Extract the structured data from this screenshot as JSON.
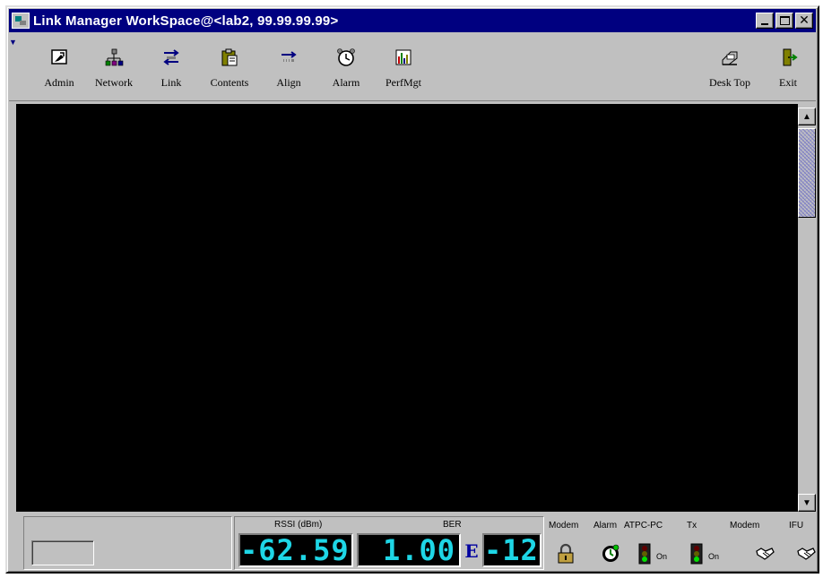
{
  "window": {
    "title": "Link Manager WorkSpace@<lab2, 99.99.99.99>"
  },
  "titlebar_buttons": {
    "minimize": "_",
    "maximize": "□",
    "close": "✕"
  },
  "toolbar": {
    "items": [
      {
        "label": "Admin",
        "icon": "admin-icon"
      },
      {
        "label": "Network",
        "icon": "network-icon"
      },
      {
        "label": "Link",
        "icon": "link-icon"
      },
      {
        "label": "Contents",
        "icon": "clipboard-icon"
      },
      {
        "label": "Align",
        "icon": "align-icon"
      },
      {
        "label": "Alarm",
        "icon": "alarm-clock-icon"
      },
      {
        "label": "PerfMgt",
        "icon": "performance-chart-icon"
      },
      {
        "label": "Desk Top",
        "icon": "desktop-icon"
      },
      {
        "label": "Exit",
        "icon": "exit-door-icon"
      }
    ]
  },
  "status": {
    "rssi_label": "RSSI (dBm)",
    "rssi_value": "-62.59",
    "ber_label": "BER",
    "ber_mantissa": "1.00",
    "ber_e": "E",
    "ber_exponent": "-12",
    "indicators": [
      {
        "label": "Modem",
        "icon": "padlock-icon"
      },
      {
        "label": "Alarm",
        "icon": "alarm-status-icon"
      },
      {
        "label": "ATPC-PC",
        "icon": "traffic-light-icon",
        "value": "On"
      },
      {
        "label": "Tx",
        "icon": "traffic-light-icon",
        "value": "On"
      },
      {
        "label": "Modem",
        "icon": "handshake-icon"
      },
      {
        "label": "IFU",
        "icon": "handshake-icon"
      }
    ]
  },
  "colors": {
    "title_bar": "#000080",
    "lcd_text": "#1ed6e6",
    "lcd_bg": "#000000",
    "canvas": "#000000",
    "face": "#c0c0c0"
  }
}
